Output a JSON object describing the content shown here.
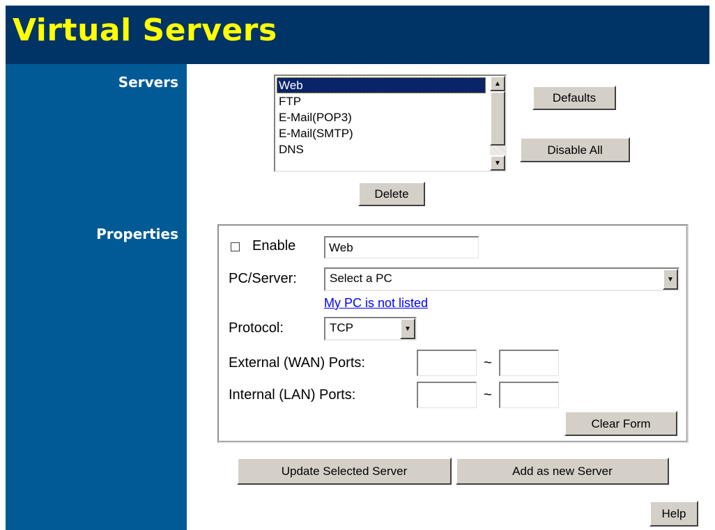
{
  "header": {
    "title": "Virtual Servers"
  },
  "sections": {
    "servers_label": "Servers",
    "properties_label": "Properties"
  },
  "servers": {
    "items": [
      "Web",
      "FTP",
      "E-Mail(POP3)",
      "E-Mail(SMTP)",
      "DNS"
    ],
    "selected": "Web",
    "defaults_label": "Defaults",
    "disable_all_label": "Disable All",
    "delete_label": "Delete"
  },
  "properties": {
    "enable_label": "Enable",
    "enabled": false,
    "name_value": "Web",
    "pc_server_label": "PC/Server:",
    "pc_server_value": "Select a PC",
    "not_listed_link": "My PC is not listed",
    "protocol_label": "Protocol:",
    "protocol_value": "TCP",
    "external_ports_label": "External (WAN) Ports:",
    "internal_ports_label": "Internal (LAN) Ports:",
    "port_separator": "~",
    "ext_port_from": "",
    "ext_port_to": "",
    "int_port_from": "",
    "int_port_to": "",
    "clear_form_label": "Clear Form"
  },
  "actions": {
    "update_label": "Update Selected Server",
    "add_label": "Add as new Server",
    "help_label": "Help"
  },
  "icons": {
    "scroll_up": "arrow-up-icon",
    "scroll_down": "arrow-down-icon",
    "dropdown": "chevron-down-icon"
  },
  "colors": {
    "header_bg": "#003366",
    "title_text": "#ffff00",
    "sidebar_bg": "#005a96",
    "selection_bg": "#0a246a",
    "link": "#0000ff"
  }
}
